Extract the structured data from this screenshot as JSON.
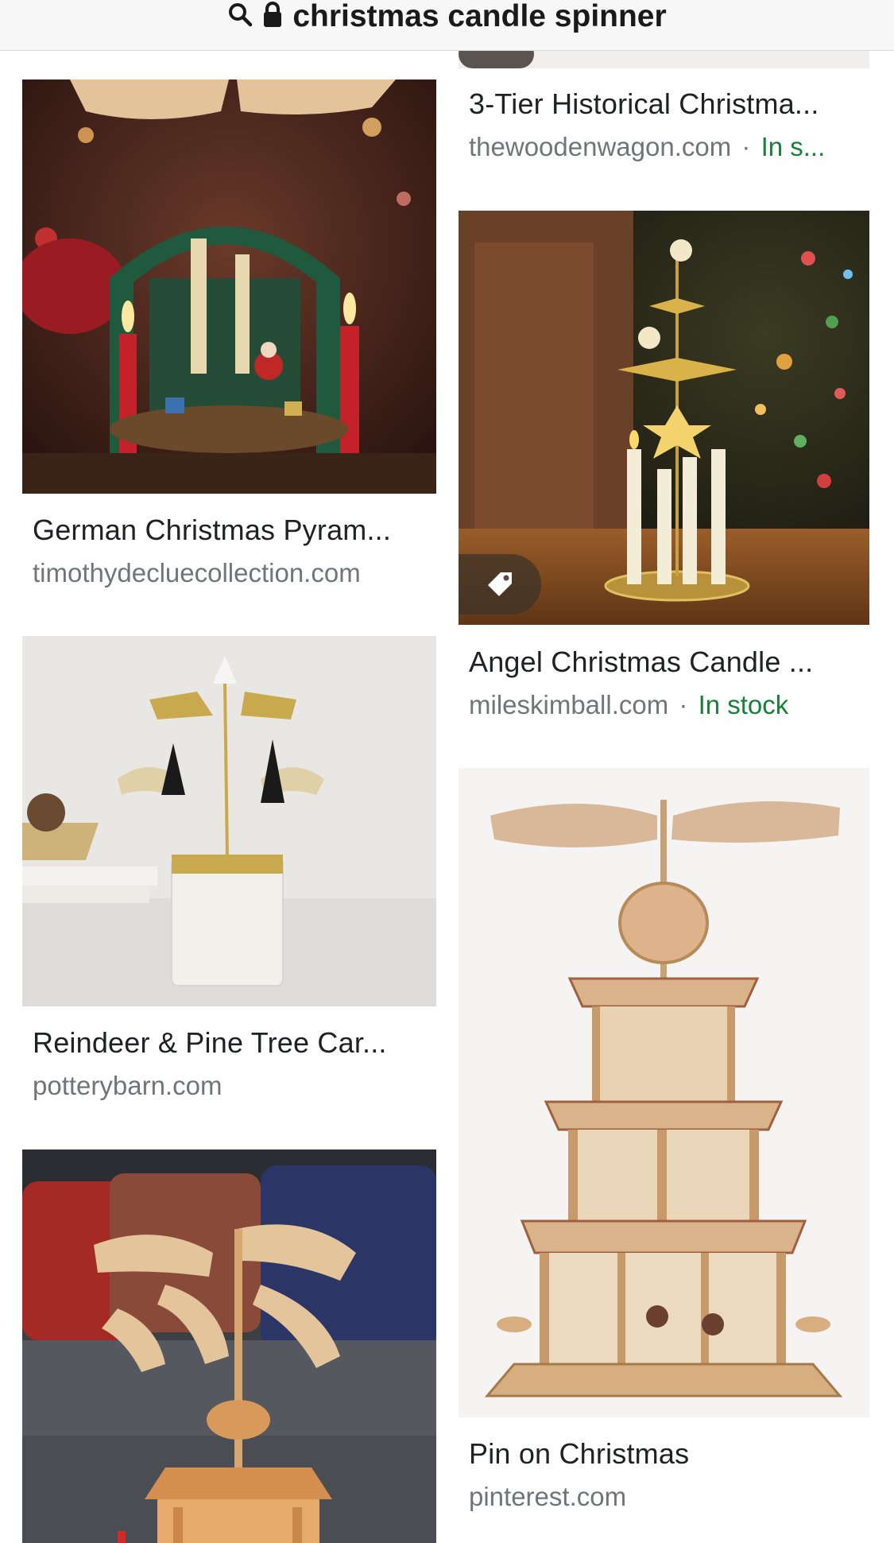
{
  "address_bar": {
    "url_text": "christmas candle spinner",
    "icons": [
      "search-icon",
      "lock-icon"
    ]
  },
  "results": [
    {
      "id": "3-tier",
      "title": "3-Tier Historical Christma...",
      "source": "thewoodenwagon.com",
      "separator": "·",
      "stock": "In s..."
    },
    {
      "id": "german",
      "title": "German Christmas Pyram...",
      "source": "timothydecluecollection.com"
    },
    {
      "id": "angel",
      "title": "Angel Christmas Candle ...",
      "source": "mileskimball.com",
      "separator": "·",
      "stock": "In stock",
      "badge_icon": "price-tag-icon"
    },
    {
      "id": "reindeer",
      "title": "Reindeer & Pine Tree Car...",
      "source": "potterybarn.com"
    },
    {
      "id": "pin",
      "title": "Pin on Christmas",
      "source": "pinterest.com"
    },
    {
      "id": "pyramid-sofa",
      "title": "",
      "source": ""
    }
  ],
  "colors": {
    "source_gray": "#70757a",
    "stock_green": "#188038",
    "title_text": "#202124"
  }
}
